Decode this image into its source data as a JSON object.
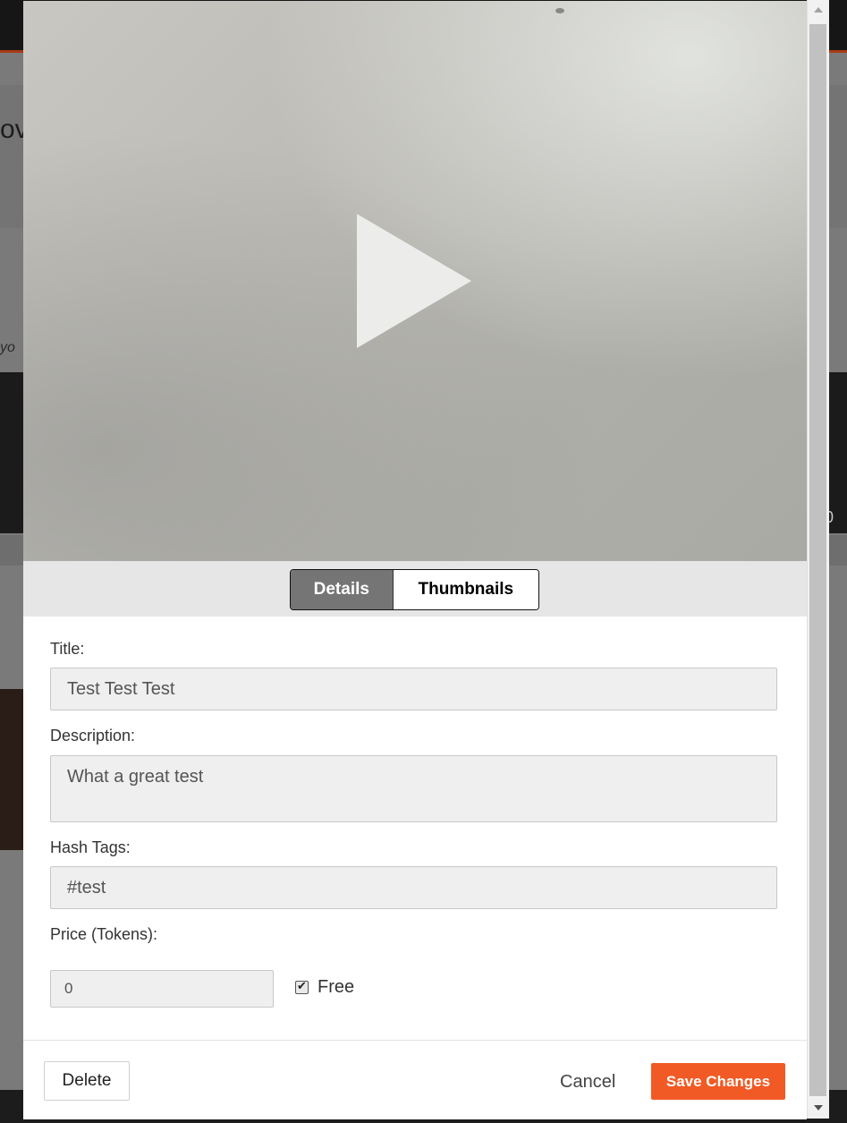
{
  "background": {
    "fragment_heading": "ov",
    "fragment_italic": "yo",
    "fragment_number": "0"
  },
  "video": {
    "play_icon": "play-icon"
  },
  "tabs": [
    {
      "label": "Details",
      "active": true
    },
    {
      "label": "Thumbnails",
      "active": false
    }
  ],
  "form": {
    "title_label": "Title:",
    "title_value": "Test Test Test",
    "description_label": "Description:",
    "description_value": "What a great test",
    "hashtags_label": "Hash Tags:",
    "hashtags_value": "#test",
    "price_label": "Price (Tokens):",
    "price_value": "0",
    "free_label": "Free",
    "free_checked": true
  },
  "footer": {
    "delete_label": "Delete",
    "cancel_label": "Cancel",
    "save_label": "Save Changes"
  },
  "colors": {
    "accent": "#f15a24",
    "active_tab": "#757575",
    "field_bg": "#efefef"
  }
}
